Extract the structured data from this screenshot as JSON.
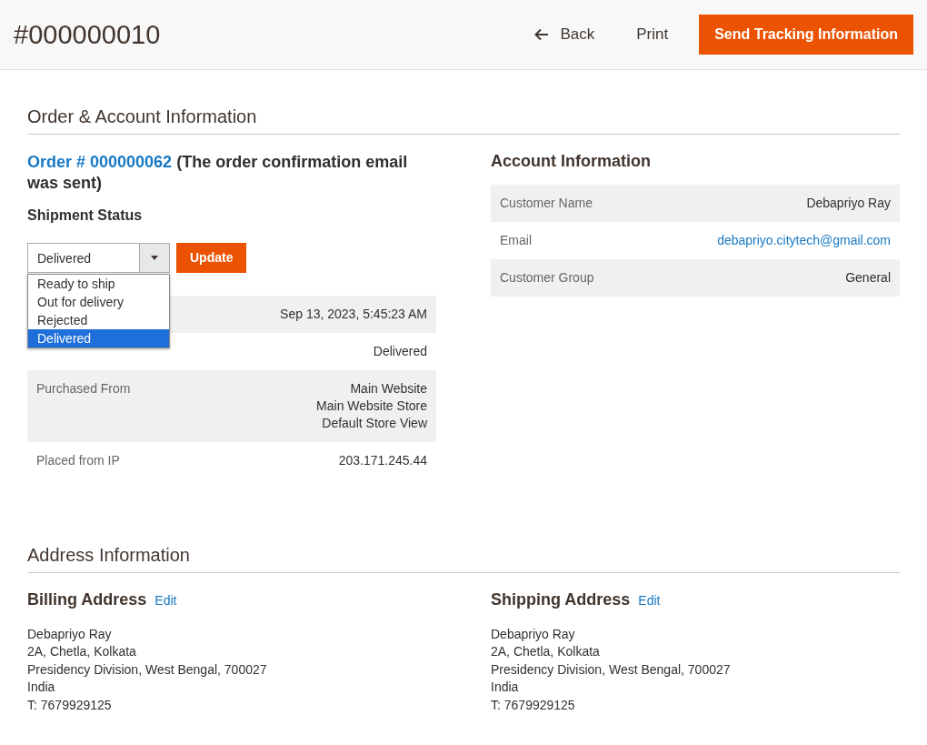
{
  "header": {
    "title": "#000000010",
    "back": "Back",
    "print": "Print",
    "send": "Send Tracking Information"
  },
  "order_account": {
    "heading": "Order & Account Information",
    "order": {
      "link": "Order # 000000062",
      "note": "(The order confirmation email was sent)",
      "shipment_status_label": "Shipment Status",
      "select": {
        "value": "Delivered",
        "expanded": true,
        "options": [
          {
            "label": "Ready to ship",
            "selected": false
          },
          {
            "label": "Out for delivery",
            "selected": false
          },
          {
            "label": "Rejected",
            "selected": false
          },
          {
            "label": "Delivered",
            "selected": true
          }
        ]
      },
      "update_button": "Update",
      "rows": [
        {
          "values": [
            "Sep 13, 2023, 5:45:23 AM"
          ]
        },
        {
          "values": [
            "Delivered"
          ]
        },
        {
          "label": "Purchased From",
          "values": [
            "Main Website",
            "Main Website Store",
            "Default Store View"
          ]
        },
        {
          "label": "Placed from IP",
          "values": [
            "203.171.245.44"
          ]
        }
      ]
    },
    "account": {
      "heading": "Account Information",
      "rows": [
        {
          "label": "Customer Name",
          "value": "Debapriyo Ray",
          "kind": "text"
        },
        {
          "label": "Email",
          "value": "debapriyo.citytech@gmail.com",
          "kind": "link"
        },
        {
          "label": "Customer Group",
          "value": "General",
          "kind": "text"
        }
      ]
    }
  },
  "address": {
    "heading": "Address Information",
    "blocks": [
      {
        "title": "Billing Address",
        "edit": "Edit",
        "lines": [
          "Debapriyo Ray",
          "2A, Chetla, Kolkata",
          "Presidency Division, West Bengal, 700027",
          "India",
          "T: 7679929125"
        ]
      },
      {
        "title": "Shipping Address",
        "edit": "Edit",
        "lines": [
          "Debapriyo Ray",
          "2A, Chetla, Kolkata",
          "Presidency Division, West Bengal, 700027",
          "India",
          "T: 7679929125"
        ]
      }
    ]
  }
}
